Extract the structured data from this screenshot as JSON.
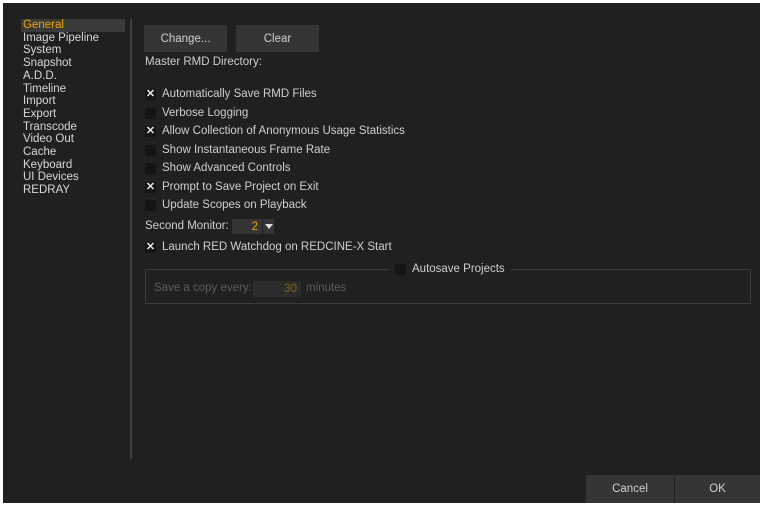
{
  "sidebar": {
    "items": [
      {
        "label": "General",
        "active": true
      },
      {
        "label": "Image Pipeline"
      },
      {
        "label": "System"
      },
      {
        "label": "Snapshot"
      },
      {
        "label": "A.D.D."
      },
      {
        "label": "Timeline"
      },
      {
        "label": "Import"
      },
      {
        "label": "Export"
      },
      {
        "label": "Transcode"
      },
      {
        "label": "Video Out"
      },
      {
        "label": "Cache"
      },
      {
        "label": "Keyboard"
      },
      {
        "label": "UI Devices"
      },
      {
        "label": "REDRAY"
      }
    ]
  },
  "directory": {
    "change_label": "Change...",
    "clear_label": "Clear",
    "label": "Master RMD Directory:"
  },
  "options": [
    {
      "label": "Automatically Save RMD Files",
      "checked": true
    },
    {
      "label": "Verbose Logging",
      "checked": false
    },
    {
      "label": "Allow Collection of Anonymous Usage Statistics",
      "checked": true
    },
    {
      "label": "Show Instantaneous Frame Rate",
      "checked": false
    },
    {
      "label": "Show Advanced Controls",
      "checked": false
    },
    {
      "label": "Prompt to Save Project on Exit",
      "checked": true
    },
    {
      "label": "Update Scopes on Playback",
      "checked": false
    }
  ],
  "second_monitor": {
    "label": "Second Monitor:",
    "value": "2"
  },
  "watchdog": {
    "label": "Launch RED Watchdog on REDCINE-X Start",
    "checked": true
  },
  "autosave": {
    "label": "Autosave Projects",
    "checked": false,
    "prefix": "Save a copy every:",
    "interval": "30",
    "suffix": "minutes"
  },
  "footer": {
    "cancel_label": "Cancel",
    "ok_label": "OK"
  },
  "colors": {
    "background": "#202020",
    "accent": "#f0a500",
    "button": "#353535"
  }
}
